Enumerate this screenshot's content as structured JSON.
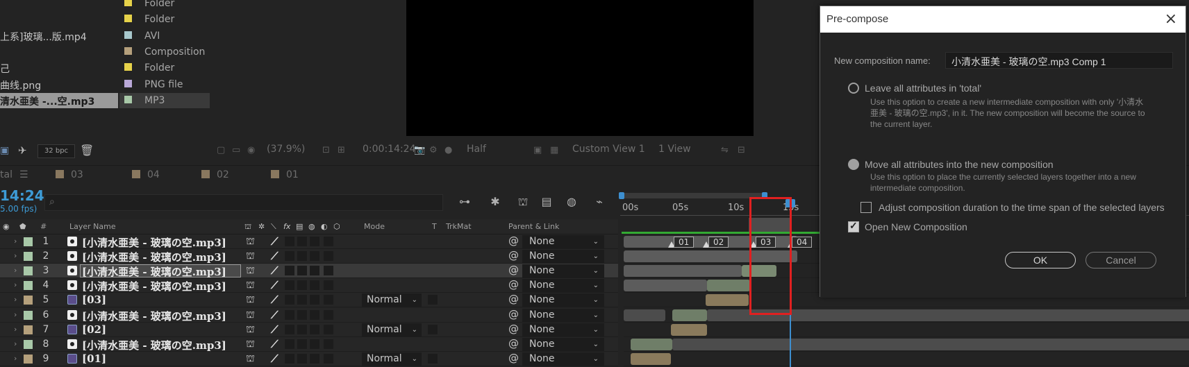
{
  "project": {
    "items": [
      {
        "name": "",
        "type": "Folder",
        "color": "#e6d24a"
      },
      {
        "name": "",
        "type": "Folder",
        "color": "#e6d24a"
      },
      {
        "name": "上系]玻璃...版.mp4",
        "type": "AVI",
        "color": "#a8c8cc"
      },
      {
        "name": "",
        "type": "Composition",
        "color": "#b5a07c"
      },
      {
        "name": "己",
        "type": "Folder",
        "color": "#e6d24a"
      },
      {
        "name": "曲线.png",
        "type": "PNG file",
        "color": "#b9a8d8"
      },
      {
        "name": "清水亜美 -...空.mp3",
        "type": "MP3",
        "color": "#a8c8a8",
        "selected": true
      }
    ],
    "bpc": "32 bpc"
  },
  "viewer": {
    "zoom": "(37.9%)",
    "timecode": "0:00:14:24",
    "resolution": "Half",
    "view": "Custom View 1",
    "views": "1 View"
  },
  "timeline": {
    "tabs": [
      "tal",
      "03",
      "04",
      "02",
      "01"
    ],
    "timecode": "14:24",
    "fps": "5.00 fps)",
    "columns": {
      "layer_name": "Layer Name",
      "mode": "Mode",
      "t": "T",
      "trkmat": "TrkMat",
      "parent": "Parent & Link",
      "num": "#"
    },
    "ruler": [
      "00s",
      "05s",
      "10s",
      "15s"
    ],
    "markers": [
      "01",
      "02",
      "03",
      "04"
    ],
    "layers": [
      {
        "num": "1",
        "name": "[小清水亜美 - 玻璃の空.mp3]",
        "kind": "audio",
        "color": "#a8c8a8",
        "mode": "",
        "parent": "None"
      },
      {
        "num": "2",
        "name": "[小清水亜美 - 玻璃の空.mp3]",
        "kind": "audio",
        "color": "#a8c8a8",
        "mode": "",
        "parent": "None"
      },
      {
        "num": "3",
        "name": "[小清水亜美 - 玻璃の空.mp3]",
        "kind": "audio",
        "color": "#a8c8a8",
        "mode": "",
        "parent": "None",
        "selected": true
      },
      {
        "num": "4",
        "name": "[小清水亜美 - 玻璃の空.mp3]",
        "kind": "audio",
        "color": "#a8c8a8",
        "mode": "",
        "parent": "None"
      },
      {
        "num": "5",
        "name": "[03]",
        "kind": "comp",
        "color": "#b5a07c",
        "mode": "Normal",
        "parent": "None"
      },
      {
        "num": "6",
        "name": "[小清水亜美 - 玻璃の空.mp3]",
        "kind": "audio",
        "color": "#a8c8a8",
        "mode": "",
        "parent": "None"
      },
      {
        "num": "7",
        "name": "[02]",
        "kind": "comp",
        "color": "#b5a07c",
        "mode": "Normal",
        "parent": "None"
      },
      {
        "num": "8",
        "name": "[小清水亜美 - 玻璃の空.mp3]",
        "kind": "audio",
        "color": "#a8c8a8",
        "mode": "",
        "parent": "None"
      },
      {
        "num": "9",
        "name": "[01]",
        "kind": "comp",
        "color": "#b5a07c",
        "mode": "Normal",
        "parent": "None"
      }
    ]
  },
  "dialog": {
    "title": "Pre-compose",
    "name_label": "New composition name:",
    "name_value": "小清水亜美 - 玻璃の空.mp3 Comp 1",
    "opt1_label": "Leave all attributes in 'total'",
    "opt1_desc": "Use this option to create a new intermediate composition with only '小清水亜美 - 玻璃の空.mp3', in it. The new composition will become the source to the current layer.",
    "opt2_label": "Move all attributes into the new composition",
    "opt2_desc": "Use this option to place the currently selected layers together into a new intermediate composition.",
    "adjust_label": "Adjust composition duration to the time span of the selected layers",
    "open_label": "Open New Composition",
    "ok": "OK",
    "cancel": "Cancel"
  }
}
